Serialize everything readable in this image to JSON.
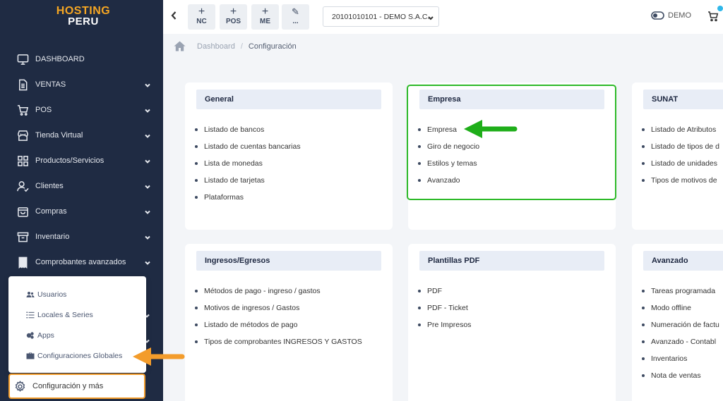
{
  "logo": {
    "line1": "HOSTING",
    "line2": "PERU"
  },
  "sidebar": {
    "items": [
      {
        "label": "DASHBOARD",
        "icon": "monitor-icon"
      },
      {
        "label": "VENTAS",
        "icon": "document-icon"
      },
      {
        "label": "POS",
        "icon": "cart-icon"
      },
      {
        "label": "Tienda Virtual",
        "icon": "store-icon"
      },
      {
        "label": "Productos/Servicios",
        "icon": "grid-icon"
      },
      {
        "label": "Clientes",
        "icon": "user-check-icon"
      },
      {
        "label": "Compras",
        "icon": "bag-icon"
      },
      {
        "label": "Inventario",
        "icon": "archive-icon"
      },
      {
        "label": "Comprobantes avanzados",
        "icon": "receipt-icon"
      }
    ],
    "popup": [
      {
        "label": "Usuarios",
        "icon": "users-icon"
      },
      {
        "label": "Locales & Series",
        "icon": "list-icon"
      },
      {
        "label": "Apps",
        "icon": "apps-icon"
      },
      {
        "label": "Configuraciones Globales",
        "icon": "briefcase-icon"
      }
    ],
    "config_label": "Configuración y más"
  },
  "topbar": {
    "buttons": [
      {
        "symbol": "+",
        "label": "NC"
      },
      {
        "symbol": "+",
        "label": "POS"
      },
      {
        "symbol": "+",
        "label": "ME"
      },
      {
        "symbol": "✎",
        "label": "..."
      }
    ],
    "company": "20101010101 - DEMO S.A.C.",
    "mode": "DEMO"
  },
  "breadcrumb": {
    "home": "Dashboard",
    "current": "Configuración"
  },
  "cards": [
    {
      "title": "General",
      "items": [
        "Listado de bancos",
        "Listado de cuentas bancarias",
        "Lista de monedas",
        "Listado de tarjetas",
        "Plataformas"
      ]
    },
    {
      "title": "Empresa",
      "items": [
        "Empresa",
        "Giro de negocio",
        "Estilos y temas",
        "Avanzado"
      ]
    },
    {
      "title": "SUNAT",
      "items": [
        "Listado de Atributos",
        "Listado de tipos de d",
        "Listado de unidades",
        "Tipos de motivos de"
      ]
    },
    {
      "title": "Ingresos/Egresos",
      "items": [
        "Métodos de pago - ingreso / gastos",
        "Motivos de ingresos / Gastos",
        "Listado de métodos de pago",
        "Tipos de comprobantes INGRESOS Y GASTOS"
      ]
    },
    {
      "title": "Plantillas PDF",
      "items": [
        "PDF",
        "PDF - Ticket",
        "Pre Impresos"
      ]
    },
    {
      "title": "Avanzado",
      "items": [
        "Tareas programada",
        "Modo offline",
        "Numeración de factu",
        "Avanzado - Contabl",
        "Inventarios",
        "Nota de ventas"
      ]
    }
  ],
  "colors": {
    "sidebar": "#1f2b43",
    "highlight_green": "#2db928",
    "highlight_orange": "#f39c2b",
    "card_header": "#e8edf6"
  }
}
